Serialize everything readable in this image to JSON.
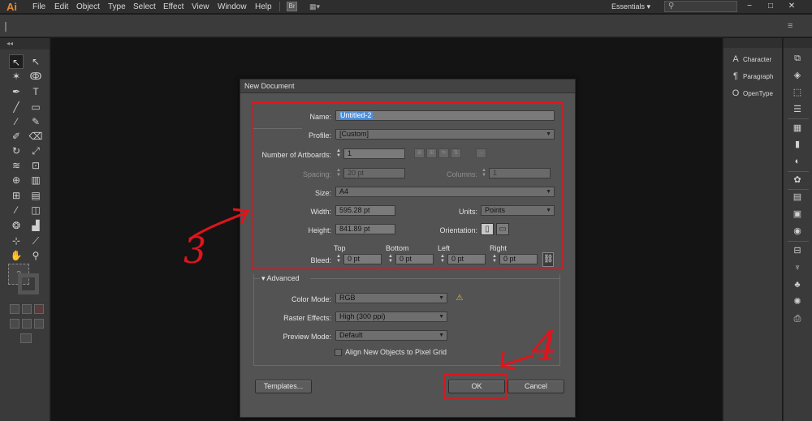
{
  "app": {
    "logo": "Ai"
  },
  "menu": {
    "items": [
      "File",
      "Edit",
      "Object",
      "Type",
      "Select",
      "Effect",
      "View",
      "Window",
      "Help"
    ]
  },
  "workspace": {
    "label": "Essentials",
    "search_placeholder": "",
    "search_icon": "search-icon"
  },
  "window_controls": {
    "minimize": "−",
    "maximize": "□",
    "close": "✕"
  },
  "right_panel": {
    "items": [
      {
        "label": "Character",
        "icon": "character-icon",
        "glyph": "A"
      },
      {
        "label": "Paragraph",
        "icon": "paragraph-icon",
        "glyph": "¶"
      },
      {
        "label": "OpenType",
        "icon": "opentype-icon",
        "glyph": "O"
      }
    ]
  },
  "dialog": {
    "title": "New Document",
    "name_label": "Name:",
    "name_value": "Untitled-2",
    "profile_label": "Profile:",
    "profile_value": "[Custom]",
    "artboards_label": "Number of Artboards:",
    "artboards_value": "1",
    "spacing_label": "Spacing:",
    "spacing_value": "20 pt",
    "columns_label": "Columns:",
    "columns_value": "1",
    "size_label": "Size:",
    "size_value": "A4",
    "width_label": "Width:",
    "width_value": "595.28 pt",
    "units_label": "Units:",
    "units_value": "Points",
    "height_label": "Height:",
    "height_value": "841.89 pt",
    "orientation_label": "Orientation:",
    "bleed_label": "Bleed:",
    "bleed_headers": {
      "top": "Top",
      "bottom": "Bottom",
      "left": "Left",
      "right": "Right"
    },
    "bleed_values": {
      "top": "0 pt",
      "bottom": "0 pt",
      "left": "0 pt",
      "right": "0 pt"
    },
    "advanced_label": "Advanced",
    "color_mode_label": "Color Mode:",
    "color_mode_value": "RGB",
    "raster_label": "Raster Effects:",
    "raster_value": "High (300 ppi)",
    "preview_label": "Preview Mode:",
    "preview_value": "Default",
    "align_label": "Align New Objects to Pixel Grid",
    "align_checked": false,
    "templates_button": "Templates...",
    "ok_button": "OK",
    "cancel_button": "Cancel"
  },
  "annotations": {
    "step_3": "3",
    "step_4": "4"
  },
  "colors": {
    "annotation_red": "#e0141c",
    "logo_orange": "#e48b2a",
    "selection_blue": "#4f8ed8"
  }
}
